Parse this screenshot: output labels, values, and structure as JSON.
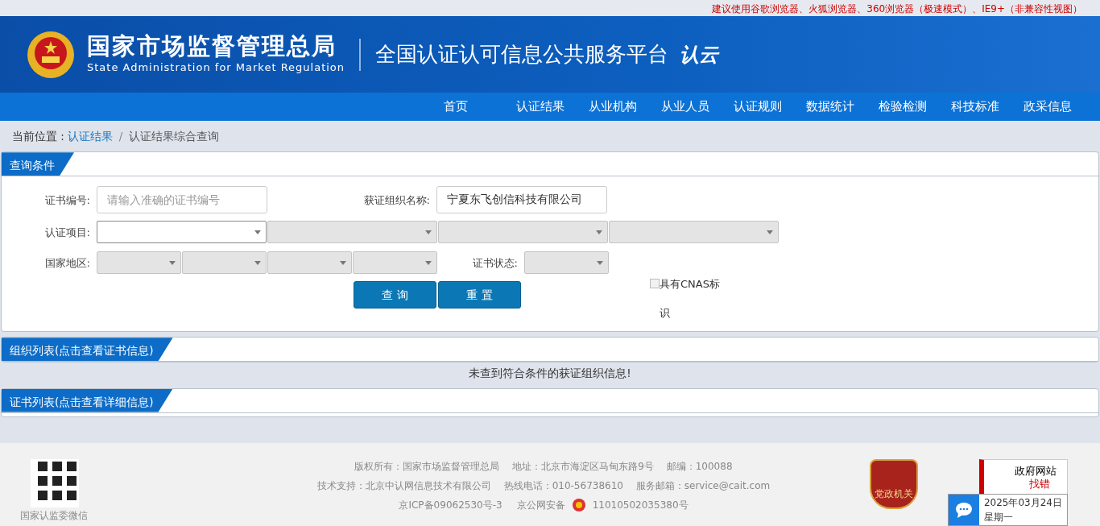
{
  "notice": "建议使用谷歌浏览器、火狐浏览器、360浏览器（极速模式）、IE9+（非兼容性视图）",
  "header": {
    "agency_cn": "国家市场监督管理总局",
    "agency_en": "State Administration  for  Market Regulation",
    "platform": "全国认证认可信息公共服务平台",
    "logo_text": "认云"
  },
  "nav": [
    "首页",
    "认证结果",
    "从业机构",
    "从业人员",
    "认证规则",
    "数据统计",
    "检验检测",
    "科技标准",
    "政采信息"
  ],
  "breadcrumb": {
    "label": "当前位置 :",
    "link": "认证结果",
    "separator": "/",
    "current": "认证结果综合查询"
  },
  "query_panel": {
    "title": "查询条件",
    "cert_no": {
      "label": "证书编号:",
      "placeholder": "请输入准确的证书编号"
    },
    "org_name": {
      "label": "获证组织名称:",
      "value": "宁夏东飞创信科技有限公司"
    },
    "project": {
      "label": "认证项目:",
      "selects": [
        {
          "disabled": false
        },
        {
          "disabled": true
        },
        {
          "disabled": true
        },
        {
          "disabled": true
        }
      ]
    },
    "region": {
      "label": "国家地区:",
      "selects": [
        {
          "disabled": true
        },
        {
          "disabled": true
        },
        {
          "disabled": true
        },
        {
          "disabled": true
        }
      ]
    },
    "status": {
      "label": "证书状态:",
      "disabled": true
    },
    "cnas": {
      "label": "具有CNAS标识",
      "checked": false
    },
    "buttons": [
      "查 询",
      "重 置"
    ]
  },
  "org_panel": {
    "title": "组织列表(点击查看证书信息)",
    "message": "未查到符合条件的获证组织信息!"
  },
  "cert_panel": {
    "title": "证书列表(点击查看详细信息)"
  },
  "footer": {
    "qr_label": "国家认监委微信",
    "lines": [
      "版权所有：国家市场监督管理总局　 地址：北京市海淀区马甸东路9号　 邮编：100088",
      "技术支持：北京中认网信息技术有限公司　 热线电话：010-56738610　 服务邮箱：service@cait.com"
    ],
    "icp": "京ICP备09062530号-3",
    "police": "京公网安备",
    "police_no": "11010502035380号",
    "party_badge": "党政机关",
    "gov_badge_top": "政府网站",
    "gov_badge_bottom": "找错"
  },
  "date_widget": {
    "date": "2025年03月24日",
    "weekday": "星期一"
  }
}
